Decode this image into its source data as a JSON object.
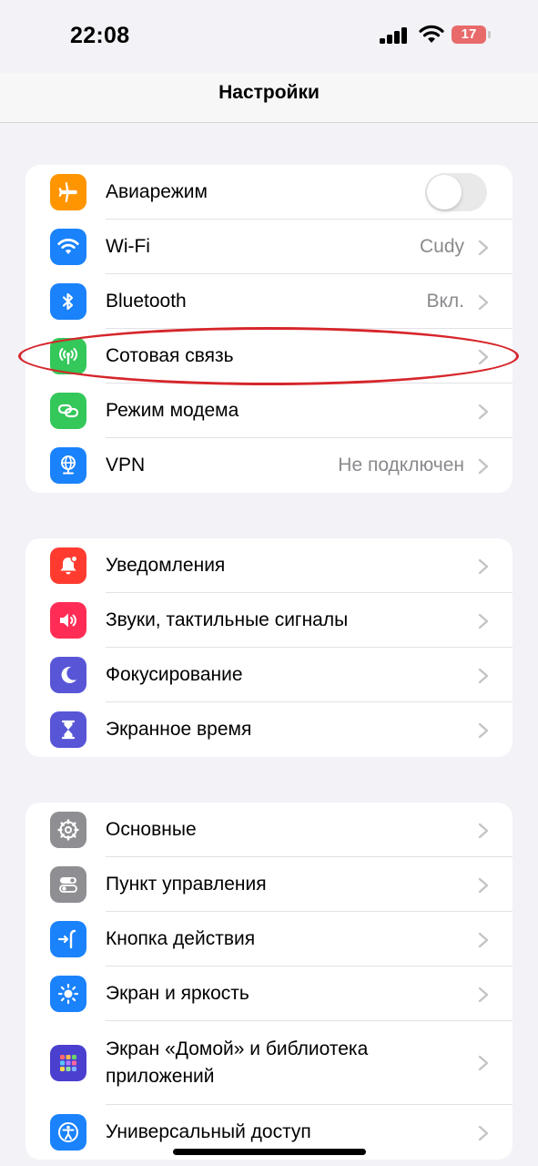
{
  "status_bar": {
    "time": "22:08",
    "battery_level": "17"
  },
  "nav": {
    "title": "Настройки"
  },
  "groups": [
    {
      "items": [
        {
          "label": "Авиарежим",
          "toggle": false,
          "icon": "airplane-icon",
          "color": "#ff9500"
        },
        {
          "label": "Wi-Fi",
          "value": "Cudy",
          "icon": "wifi-icon",
          "color": "#1a82fb"
        },
        {
          "label": "Bluetooth",
          "value": "Вкл.",
          "icon": "bluetooth-icon",
          "color": "#1a82fb"
        },
        {
          "label": "Сотовая связь",
          "icon": "antenna-icon",
          "color": "#34c759"
        },
        {
          "label": "Режим модема",
          "icon": "link-icon",
          "color": "#34c759"
        },
        {
          "label": "VPN",
          "value": "Не подключен",
          "icon": "globe-icon",
          "color": "#1a82fb"
        }
      ]
    },
    {
      "items": [
        {
          "label": "Уведомления",
          "icon": "bell-icon",
          "color": "#ff3b30"
        },
        {
          "label": "Звуки, тактильные сигналы",
          "icon": "speaker-icon",
          "color": "#ff2d55"
        },
        {
          "label": "Фокусирование",
          "icon": "moon-icon",
          "color": "#5856d6"
        },
        {
          "label": "Экранное время",
          "icon": "hourglass-icon",
          "color": "#5856d6"
        }
      ]
    },
    {
      "items": [
        {
          "label": "Основные",
          "icon": "gear-icon",
          "color": "#8e8e93"
        },
        {
          "label": "Пункт управления",
          "icon": "switches-icon",
          "color": "#8e8e93"
        },
        {
          "label": "Кнопка действия",
          "icon": "action-button-icon",
          "color": "#1a82fb"
        },
        {
          "label": "Экран и яркость",
          "icon": "sun-icon",
          "color": "#1a82fb"
        },
        {
          "label": "Экран «Домой» и библиотека приложений",
          "icon": "home-grid-icon",
          "color": "#4b3fcf"
        },
        {
          "label": "Универсальный доступ",
          "icon": "accessibility-icon",
          "color": "#1a82fb"
        }
      ]
    }
  ],
  "highlighted_item": "Сотовая связь",
  "highlight_color": "#d6262b"
}
